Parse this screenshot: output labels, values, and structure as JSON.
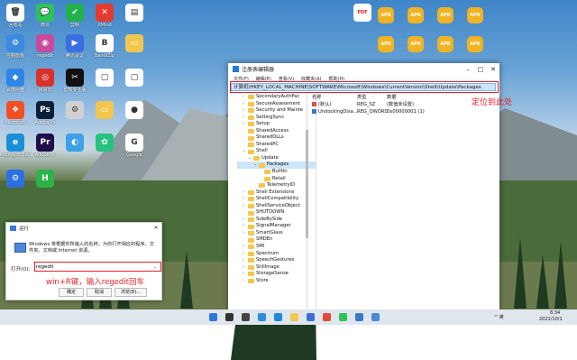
{
  "desktop": {
    "icons_left": [
      {
        "label": "回收站",
        "color": "#ffffff",
        "glyph": "🗑"
      },
      {
        "label": "微信",
        "color": "#2fc25b",
        "glyph": "💬"
      },
      {
        "label": "剪映",
        "color": "#22b14c",
        "glyph": "✔"
      },
      {
        "label": "XMind",
        "color": "#e33b2e",
        "glyph": "✕"
      },
      {
        "label": "",
        "color": "#ffffff",
        "glyph": "▤"
      },
      {
        "label": "控制面板",
        "color": "#3b8be0",
        "glyph": "⚙"
      },
      {
        "label": "regedit",
        "color": "#c84a9c",
        "glyph": "◉"
      },
      {
        "label": "腾讯会议",
        "color": "#3a6fe0",
        "glyph": "▶"
      },
      {
        "label": "BandiZip",
        "color": "#ffffff",
        "glyph": "B"
      },
      {
        "label": "",
        "color": "#f3c64d",
        "glyph": "▭"
      },
      {
        "label": "百度网盘",
        "color": "#2d86e6",
        "glyph": "◆"
      },
      {
        "label": "网易云",
        "color": "#d9302c",
        "glyph": "◎"
      },
      {
        "label": "剪映专业版",
        "color": "#111111",
        "glyph": "✂"
      },
      {
        "label": "",
        "color": "#ffffff",
        "glyph": "▢"
      },
      {
        "label": "",
        "color": "#ffffff",
        "glyph": "▢"
      },
      {
        "label": "Microsoft",
        "color": "#f25022",
        "glyph": "❖"
      },
      {
        "label": "Adobe Ps",
        "color": "#0b1e3a",
        "glyph": "Ps"
      },
      {
        "label": "",
        "color": "#d0d0d0",
        "glyph": "⚙"
      },
      {
        "label": "",
        "color": "#f3c64d",
        "glyph": "▭"
      },
      {
        "label": "",
        "color": "#ffffff",
        "glyph": "●"
      },
      {
        "label": "Microsoft Edge",
        "color": "#1a8fd8",
        "glyph": "e"
      },
      {
        "label": "Adobe Pr",
        "color": "#1e0f4a",
        "glyph": "Pr"
      },
      {
        "label": "",
        "color": "#3da0e8",
        "glyph": "◐"
      },
      {
        "label": "",
        "color": "#26c281",
        "glyph": "✿"
      },
      {
        "label": "Google",
        "color": "#ffffff",
        "glyph": "G"
      },
      {
        "label": "",
        "color": "#2d6fe0",
        "glyph": "⚙"
      },
      {
        "label": "",
        "color": "#2db34a",
        "glyph": "H"
      }
    ],
    "apk_icons": [
      "APK",
      "APK",
      "APK",
      "APK",
      "APK",
      "APK",
      "APK",
      "APK",
      "APK",
      "APK",
      "APK",
      "APK"
    ],
    "pdf_label": "PDF"
  },
  "regedit": {
    "title": "注册表编辑器",
    "menu": [
      "文件(F)",
      "编辑(E)",
      "查看(V)",
      "收藏夹(A)",
      "帮助(H)"
    ],
    "address": "计算机\\HKEY_LOCAL_MACHINE\\SOFTWARE\\Microsoft\\Windows\\CurrentVersion\\Shell\\Update\\Packages",
    "tree": [
      {
        "label": "SecondaryAuthFac",
        "indent": 1,
        "arrow": "›",
        "selected": false
      },
      {
        "label": "SecureAssessment",
        "indent": 1,
        "arrow": "›",
        "selected": false
      },
      {
        "label": "Security and Mainte",
        "indent": 1,
        "arrow": "›",
        "selected": false
      },
      {
        "label": "SettingSync",
        "indent": 1,
        "arrow": "›",
        "selected": false
      },
      {
        "label": "Setup",
        "indent": 1,
        "arrow": "›",
        "selected": false
      },
      {
        "label": "SharedAccess",
        "indent": 1,
        "arrow": "",
        "selected": false
      },
      {
        "label": "SharedDLLs",
        "indent": 1,
        "arrow": "",
        "selected": false
      },
      {
        "label": "SharedPC",
        "indent": 1,
        "arrow": "",
        "selected": false
      },
      {
        "label": "Shell",
        "indent": 1,
        "arrow": "⌄",
        "selected": false
      },
      {
        "label": "Update",
        "indent": 2,
        "arrow": "⌄",
        "selected": false
      },
      {
        "label": "Packages",
        "indent": 3,
        "arrow": "⌄",
        "selected": true
      },
      {
        "label": "BuiltIn",
        "indent": 4,
        "arrow": "",
        "selected": false
      },
      {
        "label": "Retail",
        "indent": 4,
        "arrow": "",
        "selected": false
      },
      {
        "label": "TelemetryID",
        "indent": 3,
        "arrow": "",
        "selected": false
      },
      {
        "label": "Shell Extensions",
        "indent": 1,
        "arrow": "›",
        "selected": false
      },
      {
        "label": "ShellCompatibility",
        "indent": 1,
        "arrow": "›",
        "selected": false
      },
      {
        "label": "ShellServiceObject",
        "indent": 1,
        "arrow": "›",
        "selected": false
      },
      {
        "label": "SHUTDOWN",
        "indent": 1,
        "arrow": "",
        "selected": false
      },
      {
        "label": "SideBySide",
        "indent": 1,
        "arrow": "›",
        "selected": false
      },
      {
        "label": "SignalManager",
        "indent": 1,
        "arrow": "›",
        "selected": false
      },
      {
        "label": "SmartGlass",
        "indent": 1,
        "arrow": "›",
        "selected": false
      },
      {
        "label": "SMDEn",
        "indent": 1,
        "arrow": "",
        "selected": false
      },
      {
        "label": "SMI",
        "indent": 1,
        "arrow": "›",
        "selected": false
      },
      {
        "label": "Spectrum",
        "indent": 1,
        "arrow": "›",
        "selected": false
      },
      {
        "label": "SpeechGestures",
        "indent": 1,
        "arrow": "›",
        "selected": false
      },
      {
        "label": "StillImage",
        "indent": 1,
        "arrow": "›",
        "selected": false
      },
      {
        "label": "StorageSense",
        "indent": 1,
        "arrow": "›",
        "selected": false
      },
      {
        "label": "Store",
        "indent": 1,
        "arrow": "›",
        "selected": false
      }
    ],
    "columns": [
      "名称",
      "类型",
      "数据"
    ],
    "values": [
      {
        "name": "(默认)",
        "type": "REG_SZ",
        "data": "(数值未设置)",
        "icon_color": "#d9534f"
      },
      {
        "name": "UndockingDisa...",
        "type": "REG_QWORD",
        "data": "0x00000001 (1)",
        "icon_color": "#3a78c8"
      }
    ],
    "annotation": "定位到此处"
  },
  "run_dialog": {
    "title": "运行",
    "description": "Windows 将根据你所输入的名称，为你打开相应的程序、文件夹、文档或 Internet 资源。",
    "open_label": "打开(O):",
    "input_value": "regedit",
    "annotation": "win+R键，输入regedit回车",
    "ok_label": "确定",
    "cancel_label": "取消",
    "browse_label": "浏览(B)..."
  },
  "taskbar": {
    "time": "8:34",
    "date": "2021/10/1",
    "tray_text": "^ 英",
    "icons": [
      {
        "name": "start",
        "color": "#2b78e4"
      },
      {
        "name": "search",
        "color": "#333333"
      },
      {
        "name": "taskview",
        "color": "#444444"
      },
      {
        "name": "widgets",
        "color": "#2d8de0"
      },
      {
        "name": "edge",
        "color": "#1c8ad8"
      },
      {
        "name": "explorer",
        "color": "#f3c64d"
      },
      {
        "name": "store",
        "color": "#3a6fe0"
      },
      {
        "name": "chrome",
        "color": "#dd4b39"
      },
      {
        "name": "wechat",
        "color": "#2fc25b"
      },
      {
        "name": "regedit",
        "color": "#3a78c8"
      },
      {
        "name": "run",
        "color": "#4d88d8"
      }
    ]
  }
}
